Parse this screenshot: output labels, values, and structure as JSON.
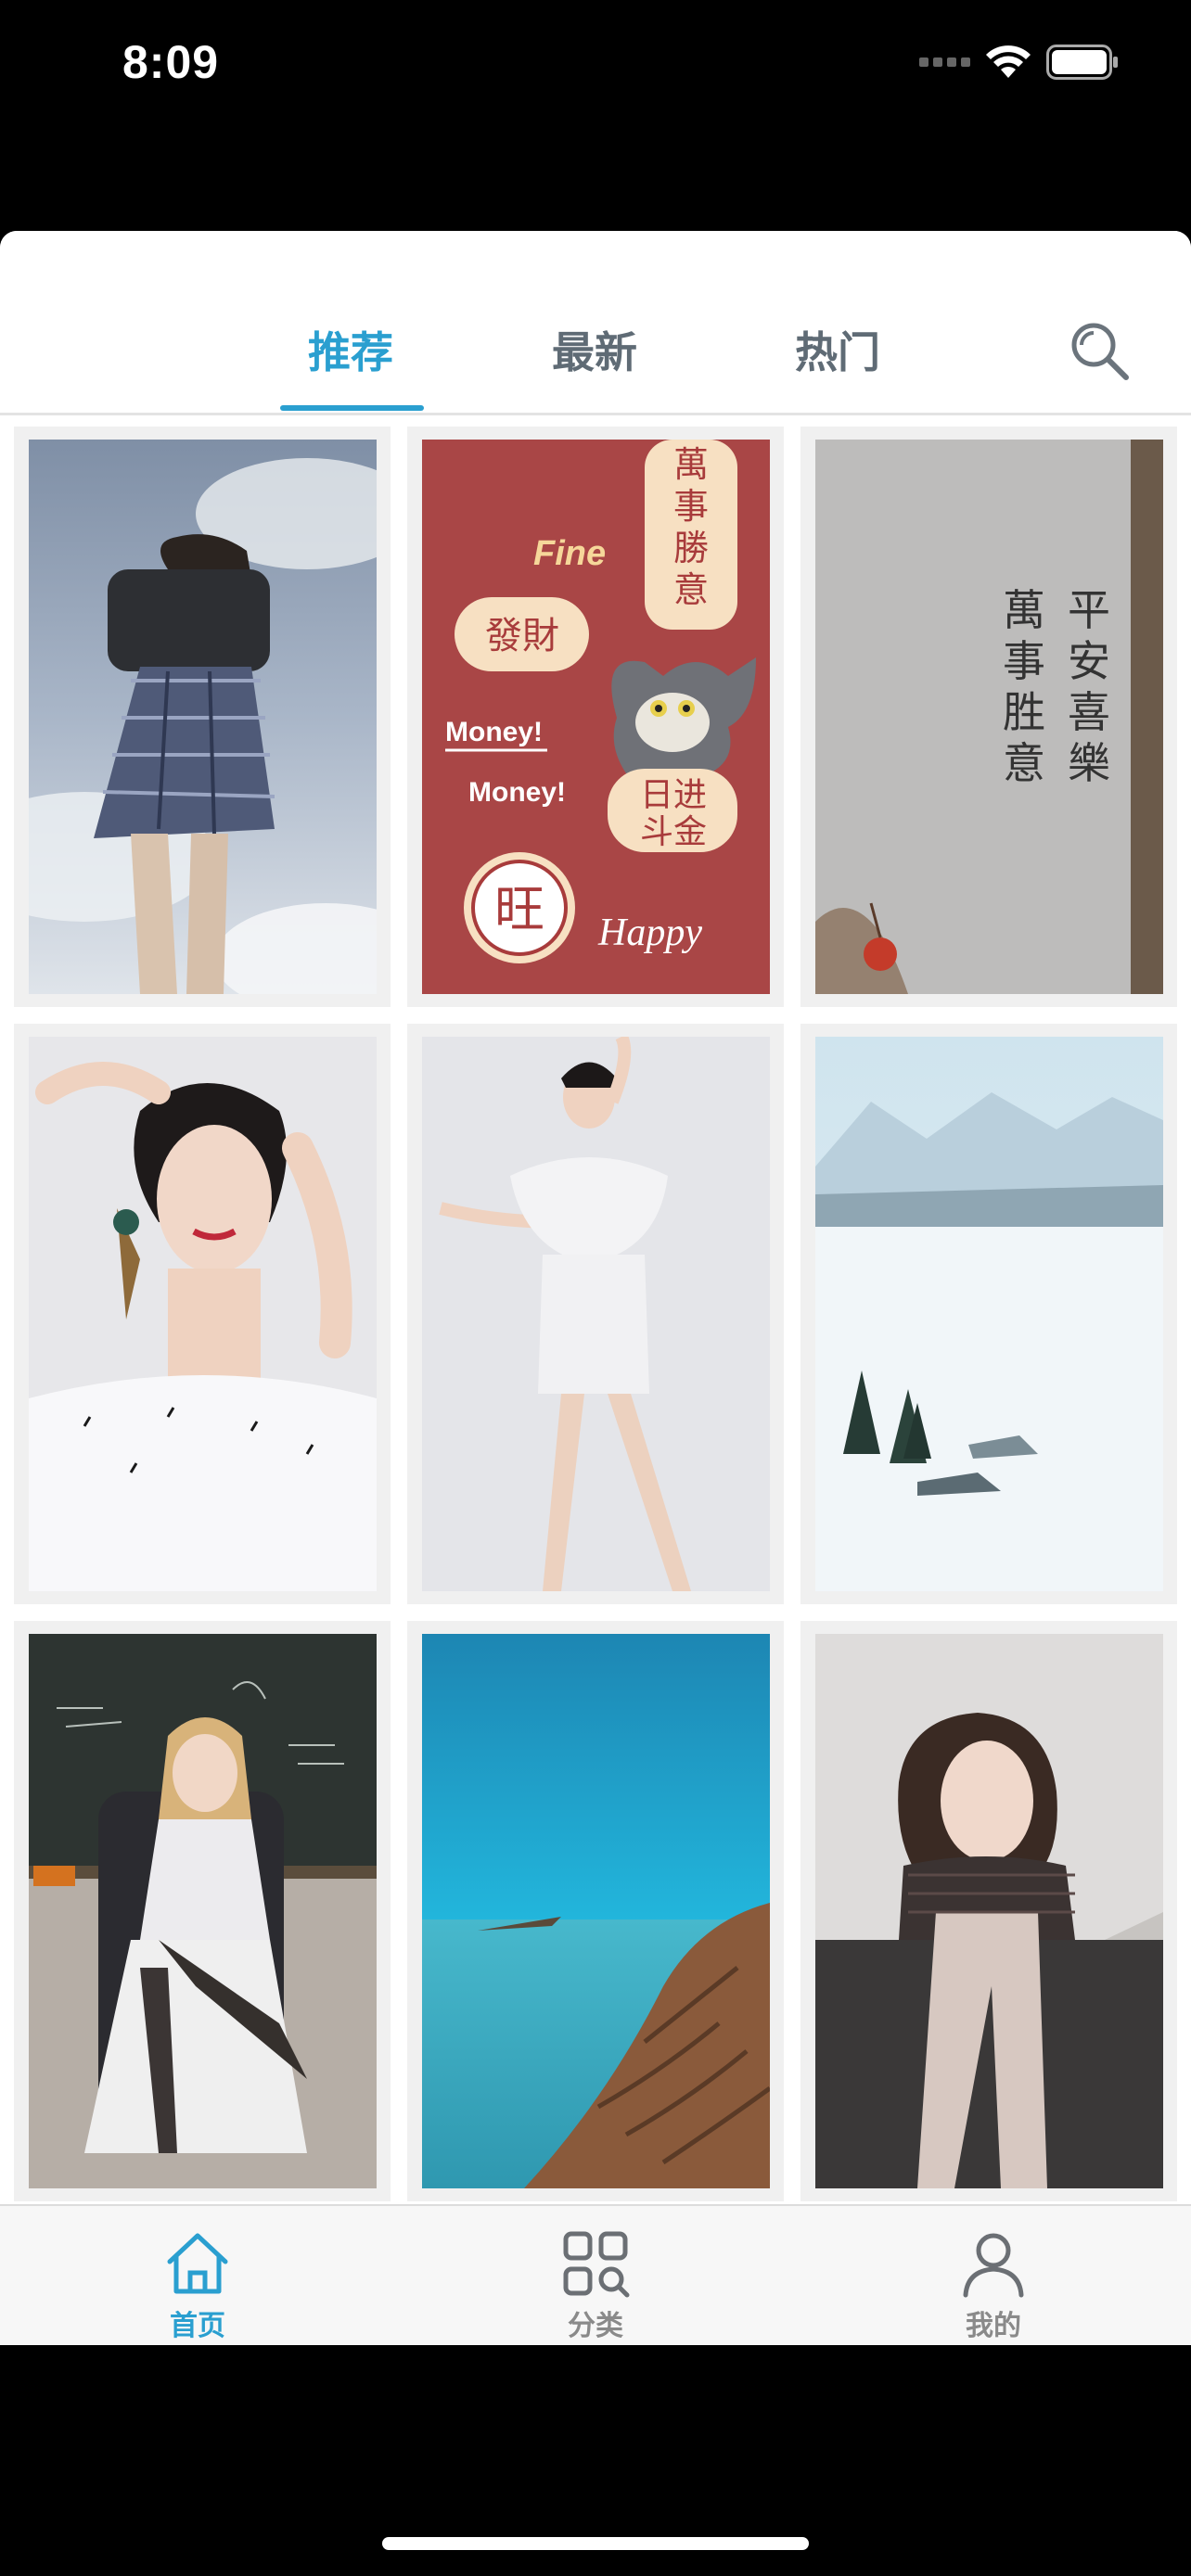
{
  "status_bar": {
    "time": "8:09"
  },
  "tabs": [
    {
      "label": "推荐",
      "active": true
    },
    {
      "label": "最新",
      "active": false
    },
    {
      "label": "热门",
      "active": false
    }
  ],
  "accent_color": "#2a9fd0",
  "search_icon": "search-icon",
  "grid": [
    {
      "name": "girl-in-plaid-skirt-sky",
      "text": []
    },
    {
      "name": "tom-cat-new-year",
      "text": [
        "萬事勝意",
        "Fine",
        "發財",
        "Money!",
        "Money!",
        "日进斗金",
        "旺",
        "Happy"
      ]
    },
    {
      "name": "calligraphy-wall",
      "text": [
        "平安喜樂",
        "萬事胜意"
      ]
    },
    {
      "name": "woman-white-feather-closeup",
      "text": []
    },
    {
      "name": "woman-white-feather-dress",
      "text": []
    },
    {
      "name": "snowy-mountain-landscape",
      "text": []
    },
    {
      "name": "anime-girl-chalkboard",
      "text": []
    },
    {
      "name": "lake-shore-blue-sky",
      "text": []
    },
    {
      "name": "girl-with-scarf-snow",
      "text": []
    }
  ],
  "bottom_nav": [
    {
      "label": "首页",
      "icon": "home-icon",
      "active": true
    },
    {
      "label": "分类",
      "icon": "category-icon",
      "active": false
    },
    {
      "label": "我的",
      "icon": "profile-icon",
      "active": false
    }
  ]
}
